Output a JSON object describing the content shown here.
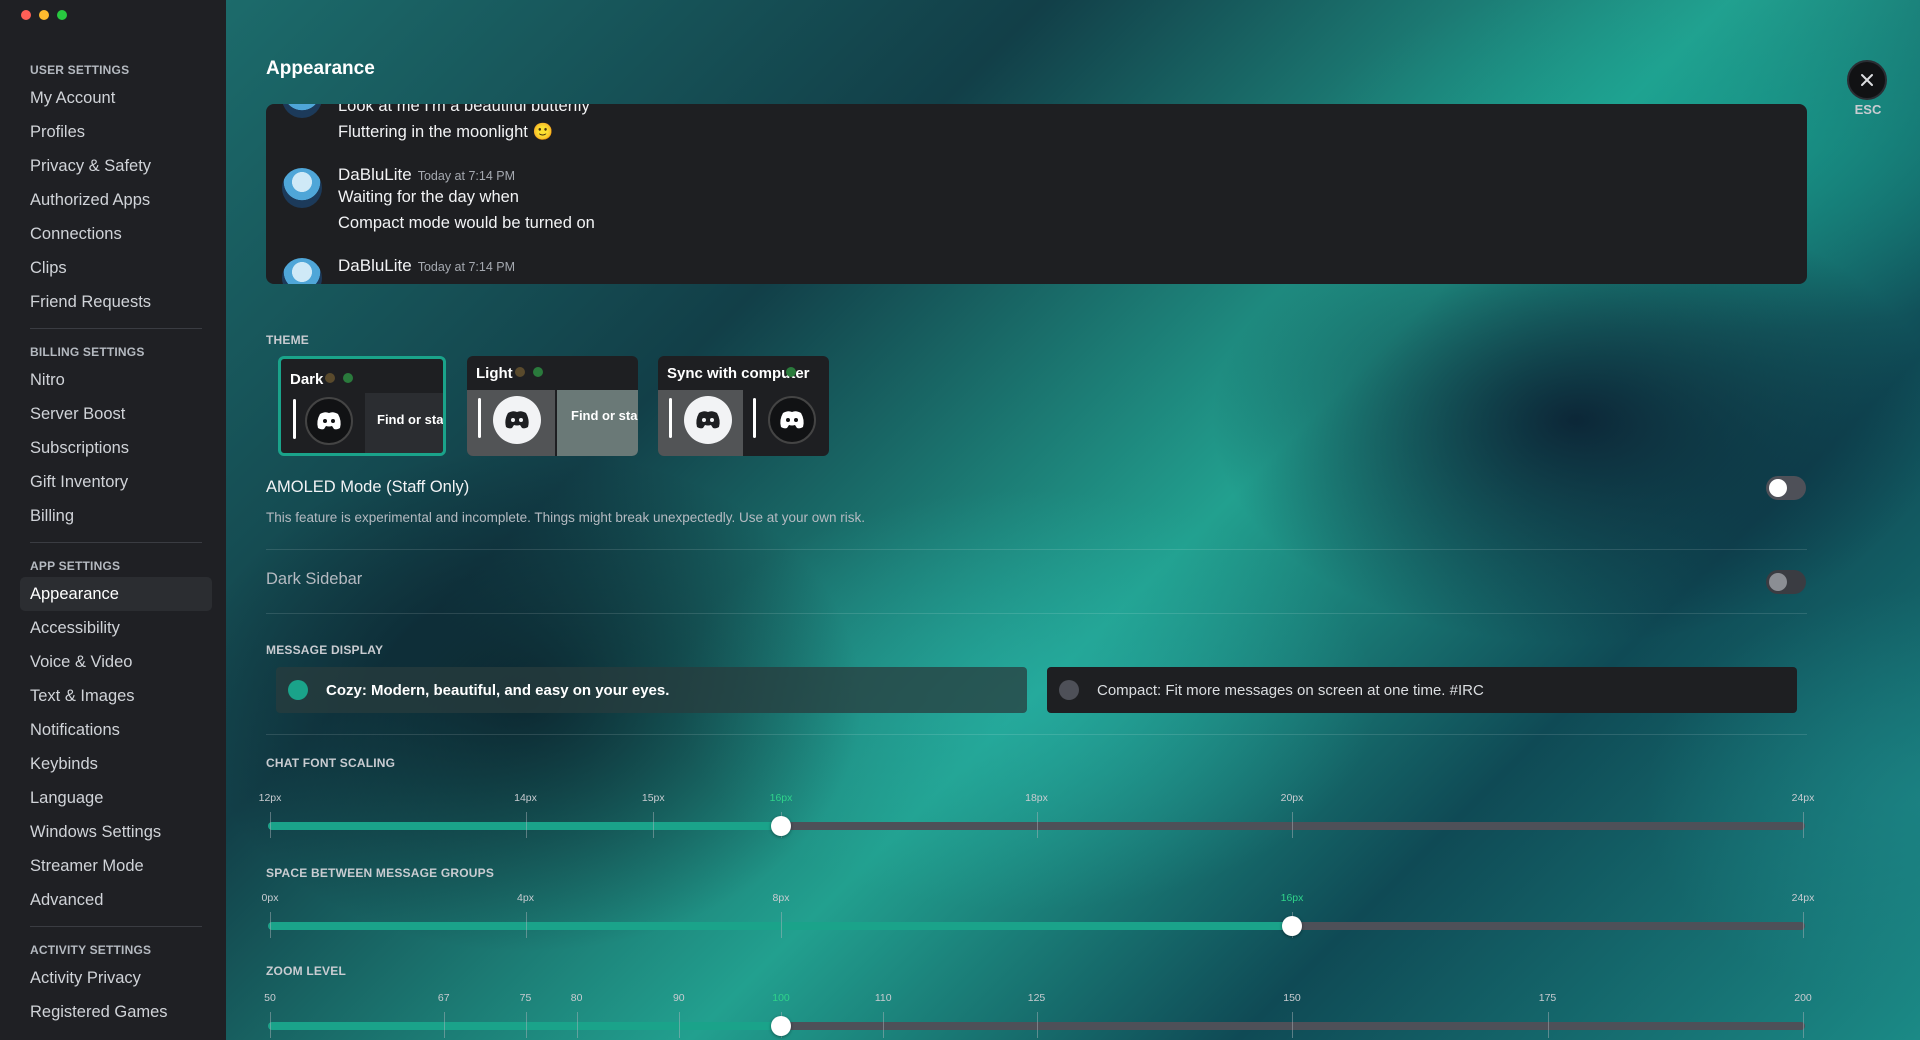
{
  "window": {
    "traffic_colors": [
      "#ff5f57",
      "#febc2e",
      "#28c840"
    ]
  },
  "sidebar": {
    "sections": [
      {
        "header": "USER SETTINGS",
        "items": [
          "My Account",
          "Profiles",
          "Privacy & Safety",
          "Authorized Apps",
          "Connections",
          "Clips",
          "Friend Requests"
        ]
      },
      {
        "header": "BILLING SETTINGS",
        "items": [
          "Nitro",
          "Server Boost",
          "Subscriptions",
          "Gift Inventory",
          "Billing"
        ]
      },
      {
        "header": "APP SETTINGS",
        "items": [
          "Appearance",
          "Accessibility",
          "Voice & Video",
          "Text & Images",
          "Notifications",
          "Keybinds",
          "Language",
          "Windows Settings",
          "Streamer Mode",
          "Advanced"
        ]
      },
      {
        "header": "ACTIVITY SETTINGS",
        "items": [
          "Activity Privacy",
          "Registered Games"
        ]
      }
    ],
    "active_item": "Appearance"
  },
  "header": {
    "title": "Appearance",
    "close_label": "ESC"
  },
  "preview": {
    "messages": [
      {
        "lines": [
          "Look at me I'm a beautiful butterfly",
          "Fluttering in the moonlight 🙂"
        ]
      },
      {
        "author": "DaBluLite",
        "time": "Today at 7:14 PM",
        "lines": [
          "Waiting for the day when",
          "Compact mode would be turned on"
        ]
      },
      {
        "author": "DaBluLite",
        "time": "Today at 7:14 PM",
        "lines": []
      }
    ]
  },
  "theme": {
    "label": "THEME",
    "options": [
      {
        "name": "Dark",
        "preview_text": "Find or sta",
        "selected": true
      },
      {
        "name": "Light",
        "preview_text": "Find or sta",
        "selected": false
      },
      {
        "name": "Sync with computer",
        "preview_text": "",
        "selected": false
      }
    ]
  },
  "amoled": {
    "title": "AMOLED Mode (Staff Only)",
    "description": "This feature is experimental and incomplete. Things might break unexpectedly. Use at your own risk.",
    "enabled": false
  },
  "dark_sidebar": {
    "title": "Dark Sidebar",
    "enabled": false
  },
  "message_display": {
    "label": "MESSAGE DISPLAY",
    "options": [
      {
        "label": "Cozy: Modern, beautiful, and easy on your eyes.",
        "selected": true
      },
      {
        "label": "Compact: Fit more messages on screen at one time. #IRC",
        "selected": false
      }
    ]
  },
  "sliders": [
    {
      "label": "CHAT FONT SCALING",
      "min": 12,
      "max": 24,
      "value": 16,
      "unit": "px",
      "ticks": [
        "12px",
        "14px",
        "15px",
        "16px",
        "18px",
        "20px",
        "24px"
      ],
      "tick_values": [
        12,
        14,
        15,
        16,
        18,
        20,
        24
      ]
    },
    {
      "label": "SPACE BETWEEN MESSAGE GROUPS",
      "min": 0,
      "max": 24,
      "value": 16,
      "unit": "px",
      "ticks": [
        "0px",
        "4px",
        "8px",
        "16px",
        "24px"
      ],
      "tick_values": [
        0,
        4,
        8,
        16,
        24
      ]
    },
    {
      "label": "ZOOM LEVEL",
      "min": 50,
      "max": 200,
      "value": 100,
      "unit": "",
      "ticks": [
        "50",
        "67",
        "75",
        "80",
        "90",
        "100",
        "110",
        "125",
        "150",
        "175",
        "200"
      ],
      "tick_values": [
        50,
        67,
        75,
        80,
        90,
        100,
        110,
        125,
        150,
        175,
        200
      ]
    }
  ],
  "colors": {
    "accent": "#1aa38a",
    "sidebar_bg": "#1f2024",
    "card_bg": "#1e1f22"
  }
}
